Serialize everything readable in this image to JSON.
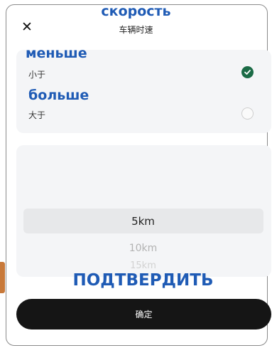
{
  "header": {
    "title": "车辆时速",
    "title_overlay": "скорость",
    "close_icon": "close-icon"
  },
  "options": [
    {
      "label": "小于",
      "overlay": "меньше",
      "selected": true
    },
    {
      "label": "大于",
      "overlay": "больше",
      "selected": false
    }
  ],
  "picker": {
    "selected": "5km",
    "items_below": [
      "10km",
      "15km"
    ]
  },
  "confirm": {
    "label": "确定",
    "overlay": "ПОДТВЕРДИТЬ"
  },
  "colors": {
    "accent": "#1b6b46",
    "overlay_text": "#1f5bb5",
    "button_bg": "#151515"
  }
}
